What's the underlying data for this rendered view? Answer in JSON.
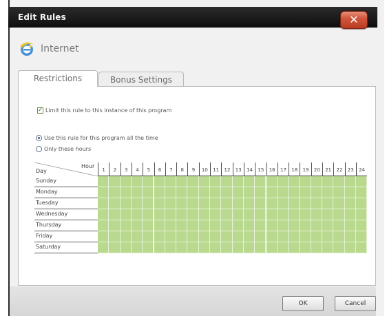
{
  "window": {
    "title": "Edit Rules",
    "close_glyph": "✕"
  },
  "app": {
    "name": "Internet",
    "icon": "internet-explorer-icon"
  },
  "tabs": [
    {
      "label": "Restrictions",
      "active": true
    },
    {
      "label": "Bonus Settings",
      "active": false
    }
  ],
  "restrictions": {
    "block_all_checked": true,
    "block_all_label": "Limit this rule to this instance of this program",
    "radio_all_label": "Use this rule for this program all the time",
    "radio_all_selected": true,
    "radio_hours_label": "Only these hours",
    "radio_hours_selected": false
  },
  "schedule": {
    "corner_day_label": "Day",
    "corner_hour_label": "Hour",
    "hours": [
      "1",
      "2",
      "3",
      "4",
      "5",
      "6",
      "7",
      "8",
      "9",
      "10",
      "11",
      "12",
      "13",
      "14",
      "15",
      "16",
      "17",
      "18",
      "19",
      "20",
      "21",
      "22",
      "23",
      "24"
    ],
    "days": [
      "Sunday",
      "Monday",
      "Tuesday",
      "Wednesday",
      "Thursday",
      "Friday",
      "Saturday"
    ],
    "slot_color": "#b9d98e"
  },
  "footer": {
    "ok_label": "OK",
    "cancel_label": "Cancel"
  },
  "colors": {
    "titlebar": "#1a1a1a",
    "close": "#c8482e",
    "allowed_slot": "#b9d98e"
  }
}
